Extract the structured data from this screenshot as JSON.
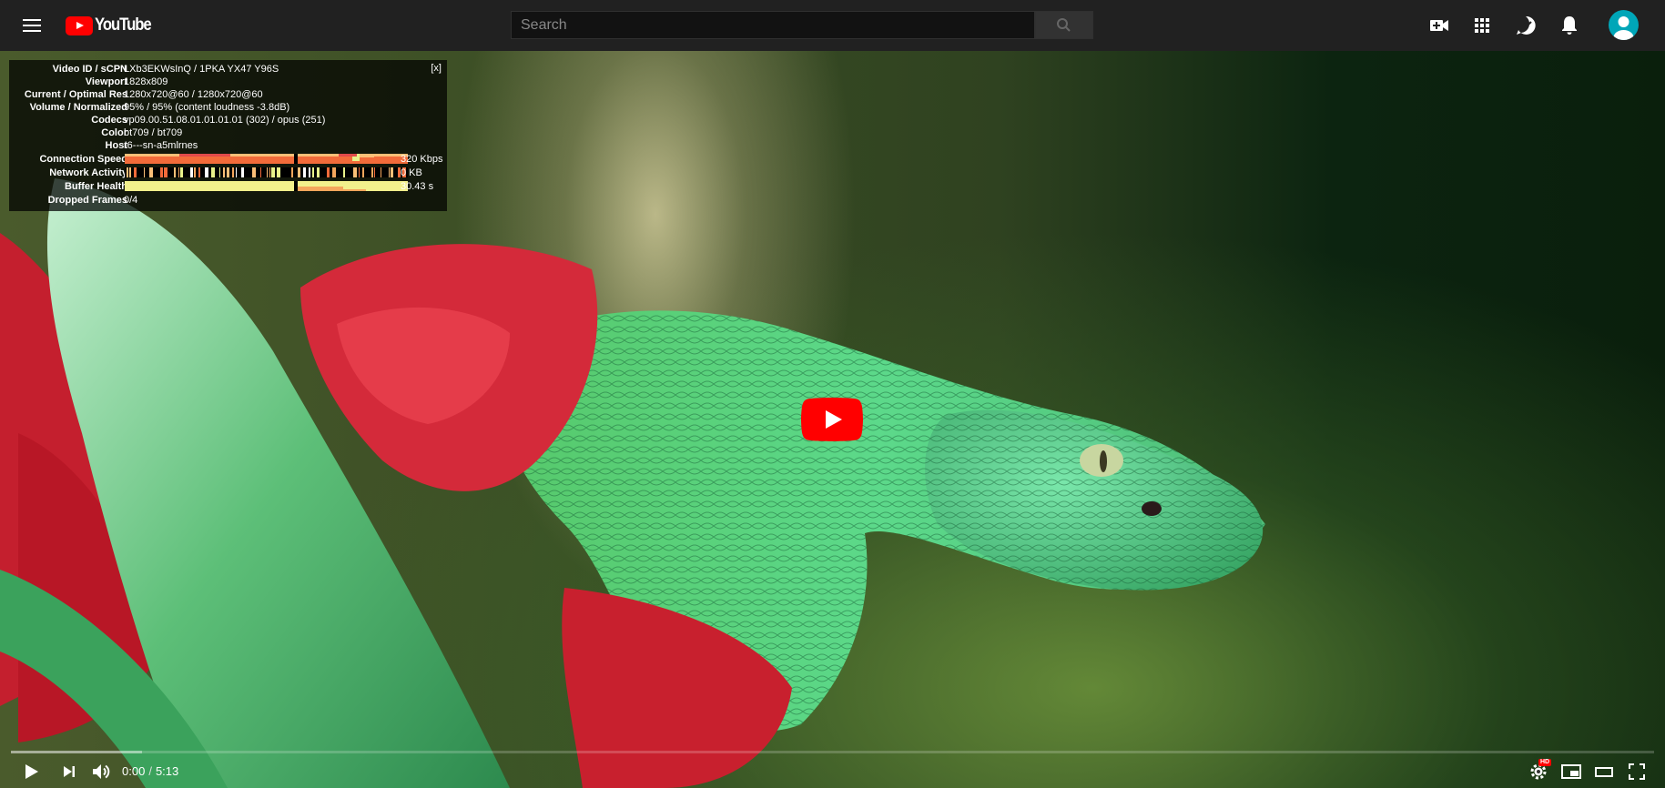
{
  "masthead": {
    "logo_text": "YouTube",
    "search_placeholder": "Search",
    "icons": [
      "menu-icon",
      "search-icon",
      "create-video-icon",
      "apps-icon",
      "messages-icon",
      "notifications-icon",
      "avatar"
    ]
  },
  "stats": {
    "close_label": "[x]",
    "rows": [
      {
        "label": "Video ID / sCPN",
        "value": "LXb3EKWsInQ / 1PKA YX47 Y96S"
      },
      {
        "label": "Viewport",
        "value": "1828x809"
      },
      {
        "label": "Current / Optimal Res",
        "value": "1280x720@60 / 1280x720@60"
      },
      {
        "label": "Volume / Normalized",
        "value": "95% / 95% (content loudness -3.8dB)"
      },
      {
        "label": "Codecs",
        "value": "vp09.00.51.08.01.01.01.01 (302) / opus (251)"
      },
      {
        "label": "Color",
        "value": "bt709 / bt709"
      },
      {
        "label": "Host",
        "value": "r6---sn-a5mlrnes"
      },
      {
        "label": "Connection Speed",
        "value": "320 Kbps"
      },
      {
        "label": "Network Activity",
        "value": "0 KB"
      },
      {
        "label": "Buffer Health",
        "value": "30.43 s"
      },
      {
        "label": "Dropped Frames",
        "value": "0/4"
      }
    ]
  },
  "player": {
    "time_current": "0:00",
    "time_separator": "/",
    "time_duration": "5:13",
    "loaded_fraction": 0.08,
    "hd_badge": "HD"
  },
  "colors": {
    "masthead_bg": "#212121",
    "brand_red": "#ff0000",
    "avatar": "#00a6b8"
  }
}
